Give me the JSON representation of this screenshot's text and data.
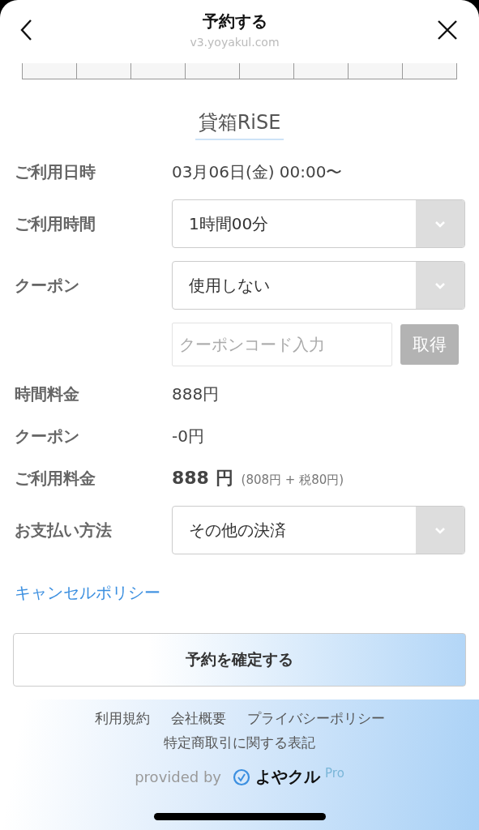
{
  "header": {
    "title": "予約する",
    "url": "v3.yoyakul.com"
  },
  "shop_name": "貸箱RiSE",
  "rows": [
    {
      "kind": "text",
      "label": "ご利用日時",
      "value": "03月06日(金) 00:00〜"
    },
    {
      "kind": "select",
      "label": "ご利用時間",
      "value": "1時間00分"
    },
    {
      "kind": "select",
      "label": "クーポン",
      "value": "使用しない"
    },
    {
      "kind": "coupon_code",
      "placeholder": "クーポンコード入力",
      "button": "取得",
      "disabled": true
    },
    {
      "kind": "text",
      "label": "時間料金",
      "value": "888円"
    },
    {
      "kind": "text",
      "label": "クーポン",
      "value": "-0円"
    },
    {
      "kind": "total",
      "label": "ご利用料金",
      "amount": "888 円",
      "detail": "(808円 + 税80円)"
    },
    {
      "kind": "select",
      "label": "お支払い方法",
      "value": "その他の決済"
    }
  ],
  "cancel_policy_link": "キャンセルポリシー",
  "confirm_button": "予約を確定する",
  "footer": {
    "links": [
      "利用規約",
      "会社概要",
      "プライバシーポリシー",
      "特定商取引に関する表記"
    ],
    "provided_by": "provided by",
    "logo_text": "よやクル",
    "logo_suffix": "Pro"
  }
}
